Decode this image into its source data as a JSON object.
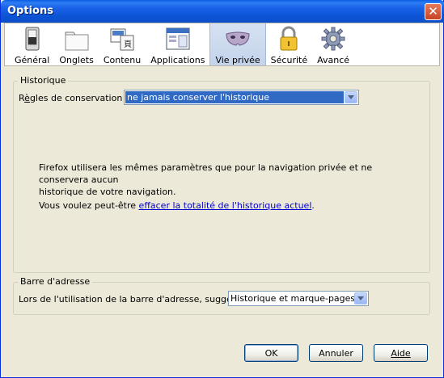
{
  "window": {
    "title": "Options"
  },
  "panes": [
    {
      "label": "Général",
      "icon": "general-icon"
    },
    {
      "label": "Onglets",
      "icon": "tabs-icon"
    },
    {
      "label": "Contenu",
      "icon": "content-icon"
    },
    {
      "label": "Applications",
      "icon": "applications-icon"
    },
    {
      "label": "Vie privée",
      "icon": "privacy-mask-icon",
      "selected": true
    },
    {
      "label": "Sécurité",
      "icon": "padlock-icon"
    },
    {
      "label": "Avancé",
      "icon": "gear-icon"
    }
  ],
  "history": {
    "group_label": "Historique",
    "rules_label_pre": "R",
    "rules_label_underlined": "è",
    "rules_label_post": "gles de conservation :",
    "rules_value": "ne jamais conserver l'historique",
    "info_line1": "Firefox utilisera les mêmes paramètres que pour la navigation privée et ne conservera aucun",
    "info_line2": "historique de votre navigation.",
    "clear_prefix": "Vous voulez peut-être ",
    "clear_link": "effacer la totalité de l'historique actuel",
    "clear_suffix": "."
  },
  "address_bar": {
    "group_label": "Barre d'adresse",
    "suggest_label": "Lors de l'utilisation de la barre d'adresse, suggérer :",
    "suggest_value": "Historique et marque-pages"
  },
  "buttons": {
    "ok": "OK",
    "cancel": "Annuler",
    "help": "Aide"
  }
}
